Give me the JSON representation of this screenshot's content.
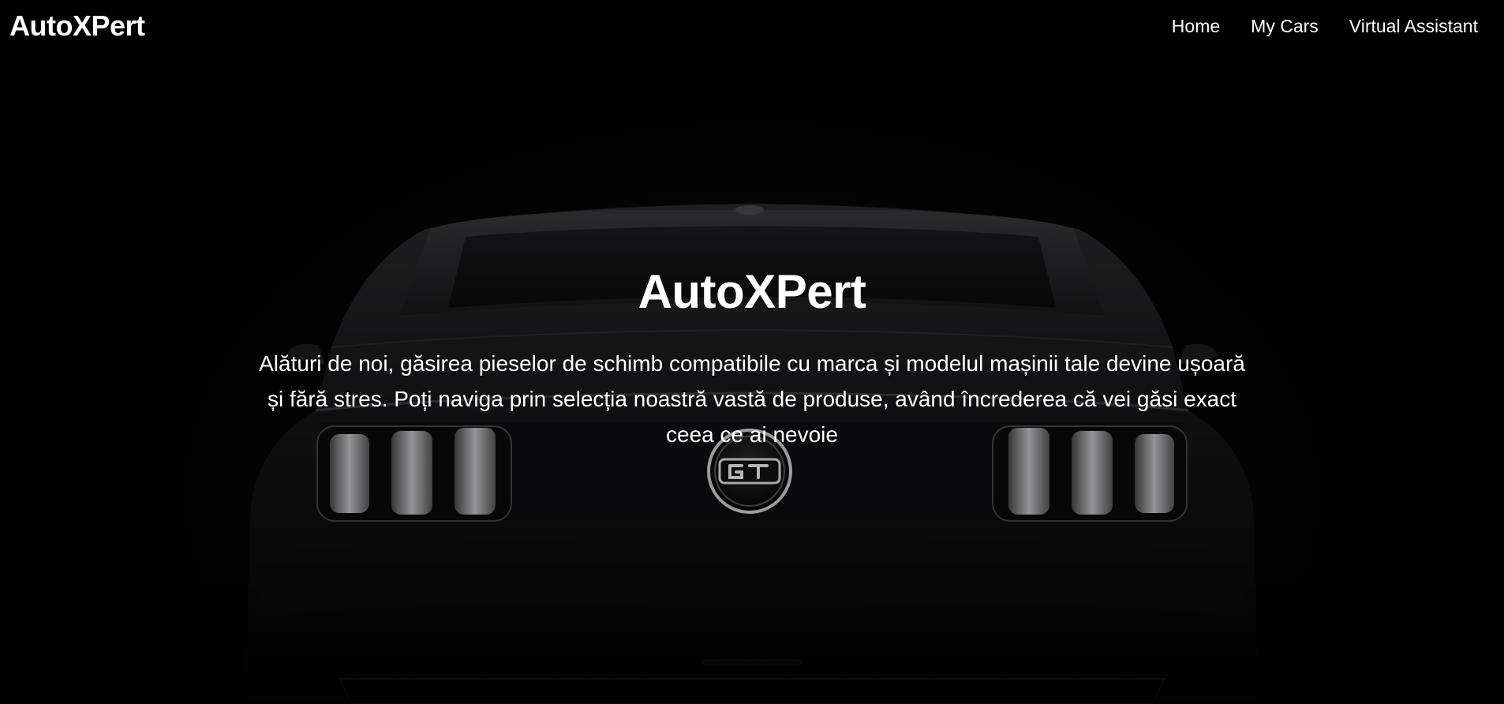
{
  "navbar": {
    "brand": "AutoXPert",
    "links": [
      {
        "label": "Home"
      },
      {
        "label": "My Cars"
      },
      {
        "label": "Virtual Assistant"
      }
    ]
  },
  "hero": {
    "title": "AutoXPert",
    "text": "Alături de noi, găsirea pieselor de schimb compatibile cu marca și modelul mașinii tale devine ușoară și fără stres. Poți naviga prin selecția noastră vastă de produse, având încrederea că vei găsi exact ceea ce ai nevoie",
    "background_image": "car-rear-gt-photo",
    "badge_icon": "gt-badge-icon"
  },
  "colors": {
    "background": "#000000",
    "text": "#ffffff"
  }
}
